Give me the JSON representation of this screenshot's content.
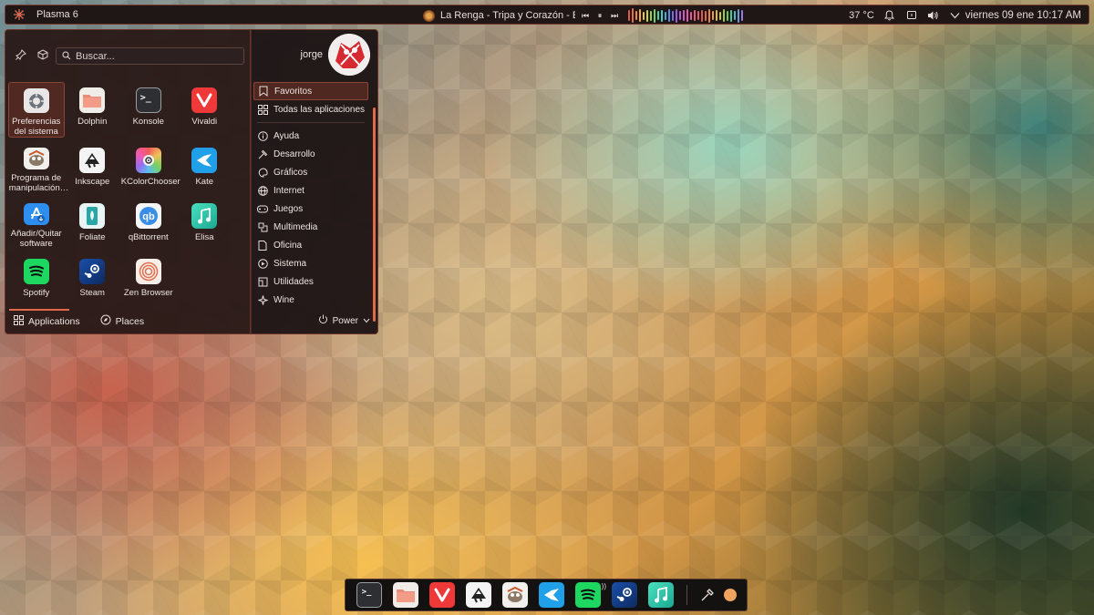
{
  "panel": {
    "plasma_label": "Plasma 6",
    "media_title": "La Renga - Tripa y Corazón - En Vivo",
    "temperature": "37 °C",
    "clock": "viernes 09 ene 10:17 AM"
  },
  "menu": {
    "search_placeholder": "Buscar...",
    "username": "jorge",
    "apps": [
      {
        "label": "Preferencias del sistema",
        "icon": "settings-icon"
      },
      {
        "label": "Dolphin",
        "icon": "folder-icon"
      },
      {
        "label": "Konsole",
        "icon": "terminal-icon"
      },
      {
        "label": "Vivaldi",
        "icon": "vivaldi-icon"
      },
      {
        "label": "Programa de manipulación…",
        "icon": "gimp-icon"
      },
      {
        "label": "Inkscape",
        "icon": "inkscape-icon"
      },
      {
        "label": "KColorChooser",
        "icon": "color-chooser-icon"
      },
      {
        "label": "Kate",
        "icon": "kate-icon"
      },
      {
        "label": "Añadir/Quitar software",
        "icon": "app-store-icon"
      },
      {
        "label": "Foliate",
        "icon": "foliate-icon"
      },
      {
        "label": "qBittorrent",
        "icon": "qbittorrent-icon"
      },
      {
        "label": "Elisa",
        "icon": "music-note-icon"
      },
      {
        "label": "Spotify",
        "icon": "spotify-icon"
      },
      {
        "label": "Steam",
        "icon": "steam-icon"
      },
      {
        "label": "Zen Browser",
        "icon": "zen-browser-icon"
      }
    ],
    "bottom_tabs": [
      "Applications",
      "Places"
    ],
    "categories_top": [
      "Favoritos",
      "Todas las aplicaciones"
    ],
    "categories": [
      "Ayuda",
      "Desarrollo",
      "Gráficos",
      "Internet",
      "Juegos",
      "Multimedia",
      "Oficina",
      "Sistema",
      "Utilidades",
      "Wine"
    ],
    "power_label": "Power"
  },
  "colors": {
    "accent": "#e06a4a",
    "panel_bg": "#1f1716"
  }
}
